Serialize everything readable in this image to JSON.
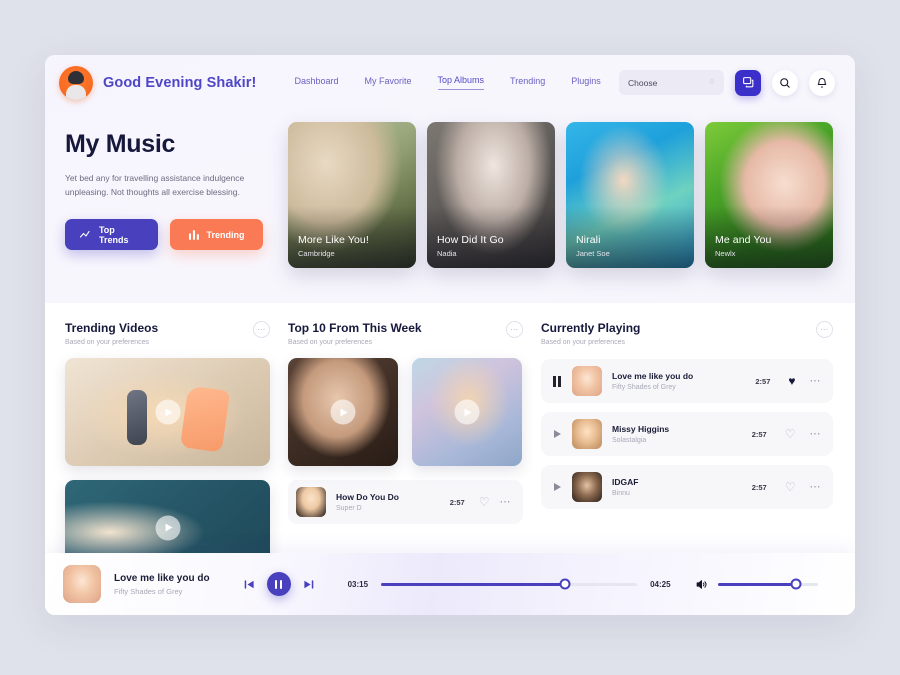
{
  "header": {
    "greeting": "Good Evening Shakir!",
    "avatar_icon": "user-avatar-icon",
    "nav": [
      {
        "label": "Dashboard",
        "active": false
      },
      {
        "label": "My Favorite",
        "active": false
      },
      {
        "label": "Top Albums",
        "active": true
      },
      {
        "label": "Trending",
        "active": false
      },
      {
        "label": "Plugins",
        "active": false
      }
    ],
    "select": {
      "value": "Choose",
      "icon": "stepper-icon"
    },
    "actions": [
      {
        "name": "chat-button",
        "icon": "chat-bubbles-icon"
      },
      {
        "name": "search-button",
        "icon": "search-icon"
      },
      {
        "name": "notifications-button",
        "icon": "bell-icon"
      }
    ]
  },
  "hero": {
    "title": "My Music",
    "description": "Yet bed any for travelling assistance indulgence unpleasing. Not thoughts all exercise blessing.",
    "buttons": [
      {
        "label": "Top Trends",
        "icon": "trend-line-icon",
        "color": "#4840bd"
      },
      {
        "label": "Trending",
        "icon": "bar-chart-icon",
        "color": "#fa7a55"
      }
    ],
    "albums": [
      {
        "title": "More Like You!",
        "artist": "Cambridge",
        "art": "art-a"
      },
      {
        "title": "How Did It Go",
        "artist": "Nadia",
        "art": "art-b"
      },
      {
        "title": "Nirali",
        "artist": "Janet Soe",
        "art": "art-c"
      },
      {
        "title": "Me and You",
        "artist": "Newlx",
        "art": "art-d"
      }
    ]
  },
  "sections": {
    "trending": {
      "title": "Trending Videos",
      "subtitle": "Based on your preferences",
      "menu_icon": "more-options-icon"
    },
    "top10": {
      "title": "Top 10 From This Week",
      "subtitle": "Based on your preferences",
      "menu_icon": "more-options-icon"
    },
    "playing": {
      "title": "Currently Playing",
      "subtitle": "Based on your preferences",
      "menu_icon": "more-options-icon"
    }
  },
  "top10_song": {
    "title": "How Do You Do",
    "artist": "Super D",
    "duration": "2:57",
    "favorited": false
  },
  "playlist": [
    {
      "title": "Love me like you do",
      "artist": "Fifty Shades of Grey",
      "duration": "2:57",
      "playing": true,
      "favorited": true
    },
    {
      "title": "Missy Higgins",
      "artist": "Solastalgia",
      "duration": "2:57",
      "playing": false,
      "favorited": false
    },
    {
      "title": "IDGAF",
      "artist": "Binnu",
      "duration": "2:57",
      "playing": false,
      "favorited": false
    }
  ],
  "player": {
    "title": "Love me like you do",
    "artist": "Fifty Shades of Grey",
    "elapsed": "03:15",
    "total": "04:25",
    "progress_percent": 72,
    "volume_percent": 78,
    "prev_icon": "skip-previous-icon",
    "play_icon": "pause-icon",
    "next_icon": "skip-next-icon",
    "volume_icon": "volume-icon",
    "accent_color": "#4840bd"
  }
}
